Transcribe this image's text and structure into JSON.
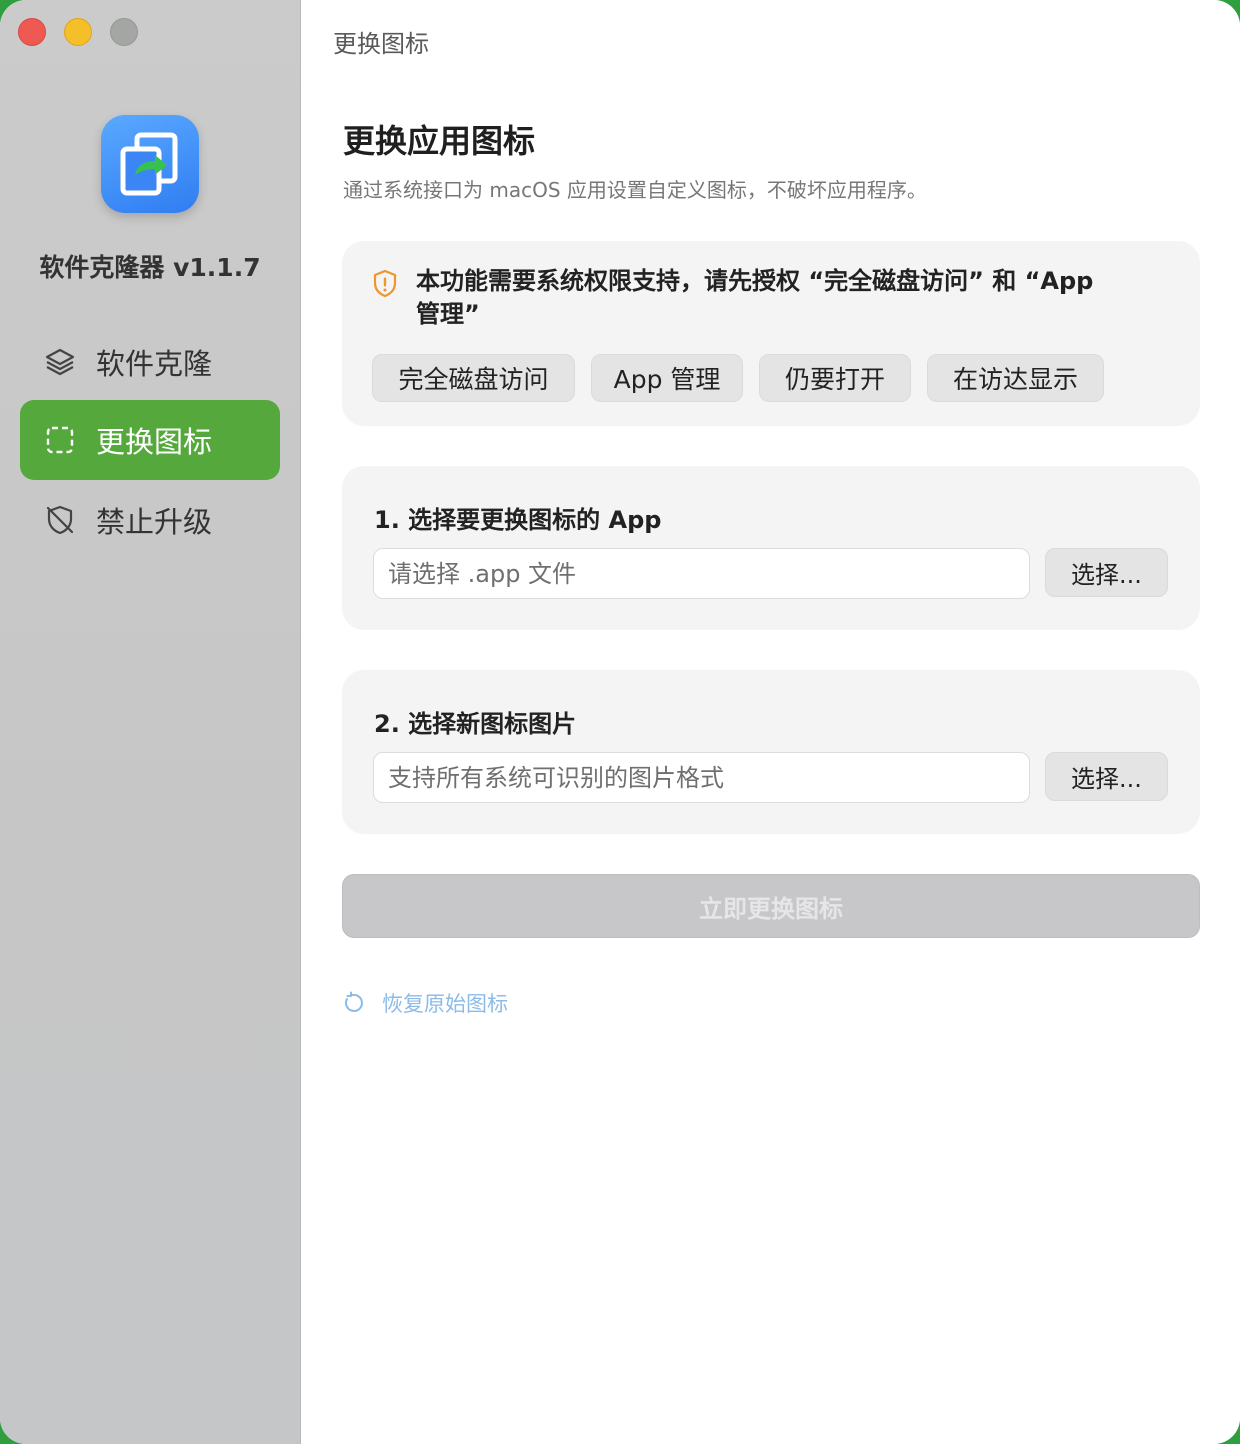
{
  "sidebar": {
    "app_name": "软件克隆器 v1.1.7",
    "items": [
      {
        "label": "软件克隆",
        "icon": "layers-icon",
        "active": false
      },
      {
        "label": "更换图标",
        "icon": "dashed-square-icon",
        "active": true
      },
      {
        "label": "禁止升级",
        "icon": "shield-off-icon",
        "active": false
      }
    ]
  },
  "main": {
    "breadcrumb": "更换图标",
    "title": "更换应用图标",
    "subtitle": "通过系统接口为 macOS 应用设置自定义图标，不破坏应用程序。",
    "permission": {
      "message": "本功能需要系统权限支持，请先授权 “完全磁盘访问” 和 “App 管理”",
      "buttons": [
        "完全磁盘访问",
        "App 管理",
        "仍要打开",
        "在访达显示"
      ]
    },
    "step1": {
      "label": "1. 选择要更换图标的 App",
      "placeholder": "请选择 .app 文件",
      "button": "选择..."
    },
    "step2": {
      "label": "2. 选择新图标图片",
      "placeholder": "支持所有系统可识别的图片格式",
      "button": "选择..."
    },
    "apply_button": "立即更换图标",
    "restore_link": "恢复原始图标"
  },
  "colors": {
    "accent_green": "#55a83b",
    "warning_orange": "#f0942f",
    "link_blue": "#8cbbe8",
    "disabled_button": "#c7c7c9"
  }
}
